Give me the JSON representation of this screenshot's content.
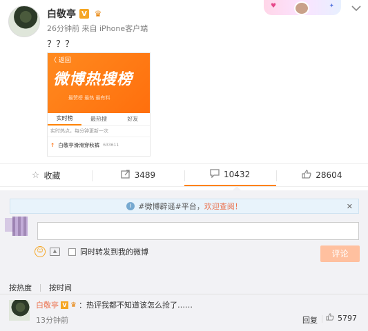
{
  "post": {
    "author": "白敬亭",
    "badge": "V",
    "meta_time": "26分钟前",
    "meta_from": "来自",
    "meta_source": "iPhone客户端",
    "content": "？？？",
    "screenshot": {
      "back": "〈 返回",
      "hero": "微博热搜榜",
      "sub": "最赞榜  最热  最有料",
      "tabs": [
        "实时榜",
        "最热搜",
        "好友"
      ],
      "note": "实时热点，每分钟更新一次",
      "row_text": "白敬亭滑滑穿秋裤",
      "row_count": "633611"
    }
  },
  "actions": {
    "favorite": "收藏",
    "repost": "3489",
    "comment": "10432",
    "like": "28604"
  },
  "comments": {
    "notice_prefix": "#微博辟谣#平台，",
    "notice_highlight": "欢迎查阅！",
    "sync_label": "同时转发到我的微博",
    "submit": "评论",
    "sort_hot": "按热度",
    "sort_time": "按时间",
    "item": {
      "name": "白敬亭",
      "text": "：热评我都不知道该怎么抢了……",
      "time": "13分钟前",
      "reply": "回复",
      "likes": "5797"
    }
  },
  "icons": [
    "star-icon",
    "repost-icon",
    "comment-icon",
    "thumbs-up-icon",
    "info-icon",
    "close-icon",
    "emoji-icon",
    "image-icon",
    "chevron-down-icon"
  ]
}
